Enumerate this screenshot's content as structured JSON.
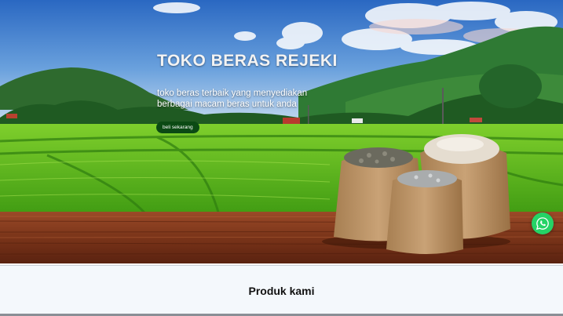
{
  "hero": {
    "title": "TOKO BERAS REJEKI",
    "subtitle": "toko beras terbaik yang menyediakan berbagai macam beras untuk anda",
    "cta_label": "beli sekarang"
  },
  "whatsapp": {
    "icon": "whatsapp-icon",
    "color": "#25d366"
  },
  "products_section": {
    "title": "Produk kami"
  },
  "colors": {
    "cta": "#0b4a14",
    "section_bg": "#f4f8fc"
  }
}
